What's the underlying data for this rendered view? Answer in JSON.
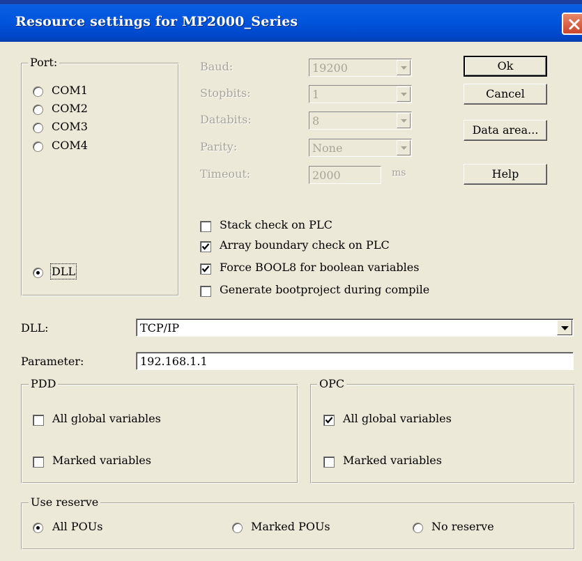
{
  "window": {
    "title": "Resource settings for MP2000_Series"
  },
  "port": {
    "title": "Port:",
    "options": [
      "COM1",
      "COM2",
      "COM3",
      "COM4"
    ],
    "dll_option": "DLL",
    "selected": "DLL"
  },
  "serial": {
    "baud_label": "Baud:",
    "baud_value": "19200",
    "stopbits_label": "Stopbits:",
    "stopbits_value": "1",
    "databits_label": "Databits:",
    "databits_value": "8",
    "parity_label": "Parity:",
    "parity_value": "None",
    "timeout_label": "Timeout:",
    "timeout_value": "2000",
    "timeout_unit": "ms"
  },
  "buttons": {
    "ok": "Ok",
    "cancel": "Cancel",
    "data_area": "Data area...",
    "help": "Help"
  },
  "options": {
    "stack_check": {
      "label": "Stack check on PLC",
      "checked": false
    },
    "array_check": {
      "label": "Array boundary check on PLC",
      "checked": true
    },
    "force_bool8": {
      "label": "Force BOOL8 for boolean variables",
      "checked": true
    },
    "bootproject": {
      "label": "Generate bootproject during compile",
      "checked": false
    }
  },
  "dll": {
    "label": "DLL:",
    "value": "TCP/IP"
  },
  "parameter": {
    "label": "Parameter:",
    "value": "192.168.1.1"
  },
  "pdd": {
    "title": "PDD",
    "all_global": {
      "label": "All global variables",
      "checked": false
    },
    "marked": {
      "label": "Marked variables",
      "checked": false
    }
  },
  "opc": {
    "title": "OPC",
    "all_global": {
      "label": "All global variables",
      "checked": true
    },
    "marked": {
      "label": "Marked variables",
      "checked": false
    }
  },
  "reserve": {
    "title": "Use reserve",
    "all_pous": "All POUs",
    "marked_pous": "Marked POUs",
    "no_reserve": "No reserve",
    "selected": "All POUs"
  },
  "colors": {
    "title_bar": "#0055dd",
    "dialog_bg": "#ece9d8",
    "disabled_text": "#a7a59a",
    "close_button": "#c9462a"
  }
}
